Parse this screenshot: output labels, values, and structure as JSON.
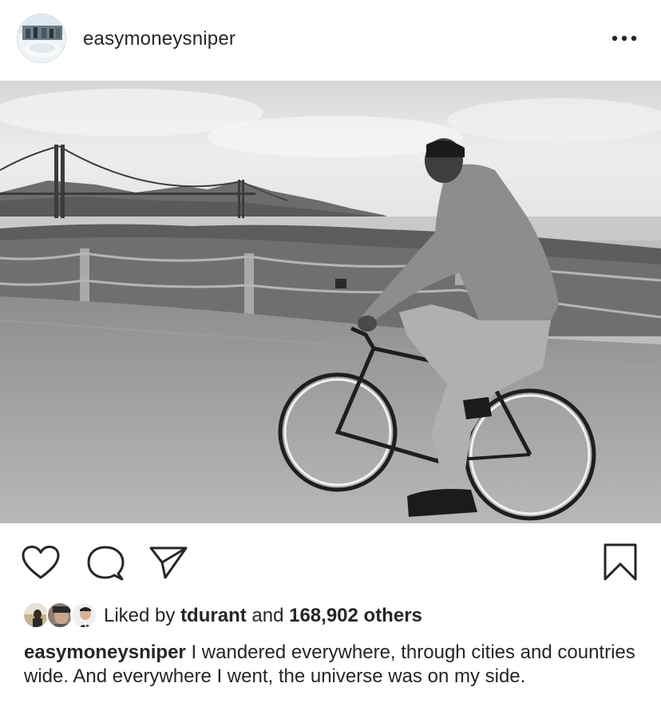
{
  "post": {
    "username": "easymoneysniper",
    "more_icon": "more-horizontal-icon"
  },
  "actions": {
    "like_icon": "heart-outline-icon",
    "comment_icon": "comment-bubble-icon",
    "share_icon": "send-paper-plane-icon",
    "save_icon": "bookmark-outline-icon"
  },
  "likes": {
    "prefix": "Liked by",
    "liked_by_user": "tdurant",
    "joiner": "and",
    "others_count": "168,902 others"
  },
  "caption": {
    "username": "easymoneysniper",
    "text": "I wandered everywhere, through cities and countries wide. And everywhere I went, the universe was on my side."
  },
  "colors": {
    "text": "#262626",
    "divider": "#dbdbdb",
    "background": "#ffffff"
  }
}
